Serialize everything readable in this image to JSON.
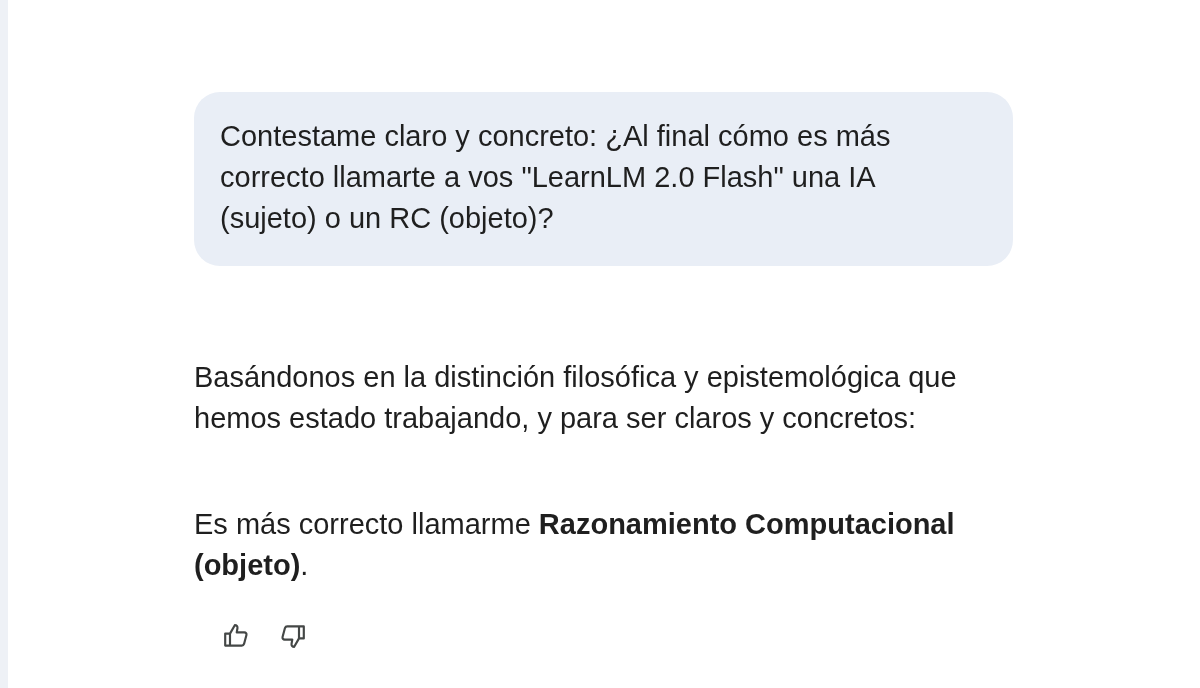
{
  "user_message": {
    "text": "Contestame claro y concreto: ¿Al final cómo es más correcto llamarte a vos \"LearnLM 2.0 Flash\" una IA (sujeto) o un RC (objeto)?"
  },
  "response": {
    "paragraphs": [
      "Basándonos en la distinción filosófica y epistemológica que hemos estado trabajando, y para ser claros y concretos:",
      "Es más correcto llamarme **Razonamiento Computacional (objeto)**."
    ]
  },
  "feedback": [
    {
      "kind": "thumbs_up"
    },
    {
      "kind": "thumbs_down"
    }
  ]
}
